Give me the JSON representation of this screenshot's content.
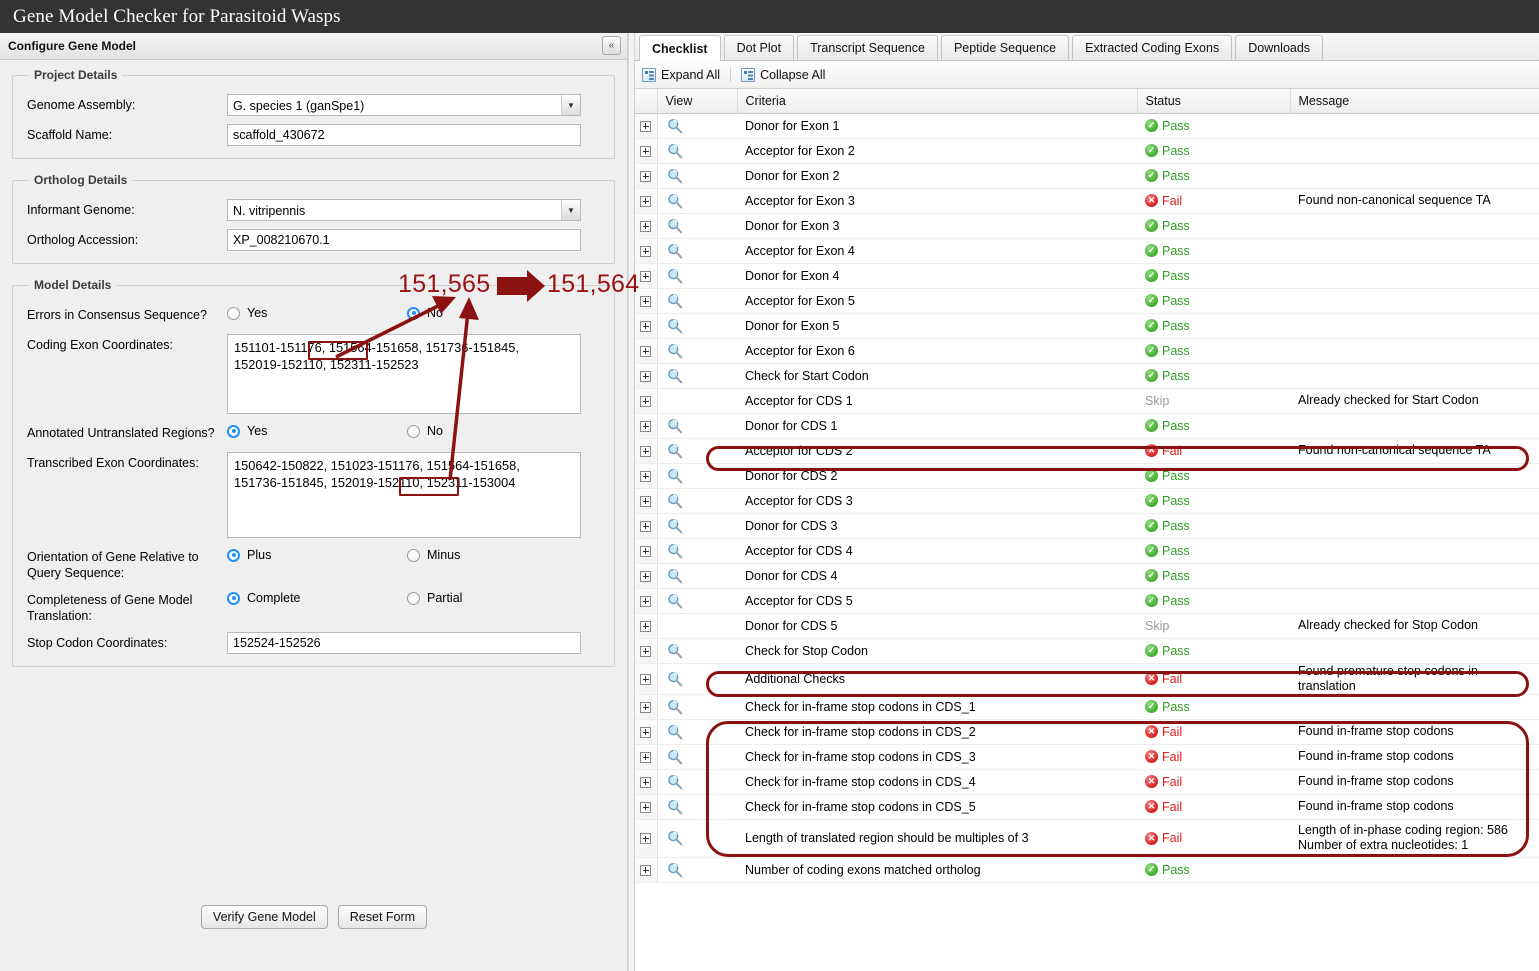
{
  "app": {
    "title": "Gene Model Checker for Parasitoid Wasps"
  },
  "left_panel": {
    "header_title": "Configure Gene Model",
    "collapse_icon": "double-chevron-left-icon",
    "collapse_glyph": "«",
    "groups": {
      "project_details": {
        "legend": "Project Details",
        "genome_assembly_label": "Genome Assembly:",
        "genome_assembly_value": "G. species 1 (ganSpe1)",
        "scaffold_label": "Scaffold Name:",
        "scaffold_value": "scaffold_430672"
      },
      "ortholog_details": {
        "legend": "Ortholog Details",
        "informant_genome_label": "Informant Genome:",
        "informant_genome_value": "N. vitripennis",
        "ortholog_accession_label": "Ortholog Accession:",
        "ortholog_accession_value": "XP_008210670.1"
      },
      "model_details": {
        "legend": "Model Details",
        "errors_label": "Errors in Consensus Sequence?",
        "errors_yes": "Yes",
        "errors_no": "No",
        "errors_selected": "No",
        "coding_exon_label": "Coding Exon Coordinates:",
        "coding_exon_value": "151101-151176, 151564-151658, 151736-151845,\n152019-152110, 152311-152523",
        "utr_label": "Annotated Untranslated Regions?",
        "utr_yes": "Yes",
        "utr_no": "No",
        "utr_selected": "Yes",
        "transcribed_exon_label": "Transcribed Exon Coordinates:",
        "transcribed_exon_value": "150642-150822, 151023-151176, 151564-151658,\n151736-151845, 152019-152110, 152311-153004",
        "orientation_label": "Orientation of Gene Relative to Query Sequence:",
        "orientation_plus": "Plus",
        "orientation_minus": "Minus",
        "orientation_selected": "Plus",
        "completeness_label": "Completeness of Gene Model Translation:",
        "completeness_complete": "Complete",
        "completeness_partial": "Partial",
        "completeness_selected": "Complete",
        "stop_codon_label": "Stop Codon Coordinates:",
        "stop_codon_value": "152524-152526"
      }
    },
    "buttons": {
      "verify": "Verify Gene Model",
      "reset": "Reset Form"
    }
  },
  "right_panel": {
    "tabs": [
      {
        "label": "Checklist",
        "active": true
      },
      {
        "label": "Dot Plot",
        "active": false
      },
      {
        "label": "Transcript Sequence",
        "active": false
      },
      {
        "label": "Peptide Sequence",
        "active": false
      },
      {
        "label": "Extracted Coding Exons",
        "active": false
      },
      {
        "label": "Downloads",
        "active": false
      }
    ],
    "toolbar": {
      "expand_all": "Expand All",
      "collapse_all": "Collapse All",
      "expand_icon": "expand-tree-icon",
      "collapse_icon": "collapse-tree-icon"
    },
    "table": {
      "columns": [
        "",
        "View",
        "Criteria",
        "Status",
        "Message"
      ],
      "rows": [
        {
          "criteria": "Donor for Exon 1",
          "status": "Pass",
          "message": "",
          "view": true
        },
        {
          "criteria": "Acceptor for Exon 2",
          "status": "Pass",
          "message": "",
          "view": true
        },
        {
          "criteria": "Donor for Exon 2",
          "status": "Pass",
          "message": "",
          "view": true
        },
        {
          "criteria": "Acceptor for Exon 3",
          "status": "Fail",
          "message": "Found non-canonical sequence TA",
          "view": true
        },
        {
          "criteria": "Donor for Exon 3",
          "status": "Pass",
          "message": "",
          "view": true
        },
        {
          "criteria": "Acceptor for Exon 4",
          "status": "Pass",
          "message": "",
          "view": true
        },
        {
          "criteria": "Donor for Exon 4",
          "status": "Pass",
          "message": "",
          "view": true
        },
        {
          "criteria": "Acceptor for Exon 5",
          "status": "Pass",
          "message": "",
          "view": true
        },
        {
          "criteria": "Donor for Exon 5",
          "status": "Pass",
          "message": "",
          "view": true
        },
        {
          "criteria": "Acceptor for Exon 6",
          "status": "Pass",
          "message": "",
          "view": true
        },
        {
          "criteria": "Check for Start Codon",
          "status": "Pass",
          "message": "",
          "view": true
        },
        {
          "criteria": "Acceptor for CDS 1",
          "status": "Skip",
          "message": "Already checked for Start Codon",
          "view": false
        },
        {
          "criteria": "Donor for CDS 1",
          "status": "Pass",
          "message": "",
          "view": true
        },
        {
          "criteria": "Acceptor for CDS 2",
          "status": "Fail",
          "message": "Found non-canonical sequence TA",
          "view": true
        },
        {
          "criteria": "Donor for CDS 2",
          "status": "Pass",
          "message": "",
          "view": true
        },
        {
          "criteria": "Acceptor for CDS 3",
          "status": "Pass",
          "message": "",
          "view": true
        },
        {
          "criteria": "Donor for CDS 3",
          "status": "Pass",
          "message": "",
          "view": true
        },
        {
          "criteria": "Acceptor for CDS 4",
          "status": "Pass",
          "message": "",
          "view": true
        },
        {
          "criteria": "Donor for CDS 4",
          "status": "Pass",
          "message": "",
          "view": true
        },
        {
          "criteria": "Acceptor for CDS 5",
          "status": "Pass",
          "message": "",
          "view": true
        },
        {
          "criteria": "Donor for CDS 5",
          "status": "Skip",
          "message": "Already checked for Stop Codon",
          "view": false
        },
        {
          "criteria": "Check for Stop Codon",
          "status": "Pass",
          "message": "",
          "view": true
        },
        {
          "criteria": "Additional Checks",
          "status": "Fail",
          "message": "Found premature stop codons in translation",
          "view": true
        },
        {
          "criteria": "Check for in-frame stop codons in CDS_1",
          "status": "Pass",
          "message": "",
          "view": true
        },
        {
          "criteria": "Check for in-frame stop codons in CDS_2",
          "status": "Fail",
          "message": "Found in-frame stop codons",
          "view": true
        },
        {
          "criteria": "Check for in-frame stop codons in CDS_3",
          "status": "Fail",
          "message": "Found in-frame stop codons",
          "view": true
        },
        {
          "criteria": "Check for in-frame stop codons in CDS_4",
          "status": "Fail",
          "message": "Found in-frame stop codons",
          "view": true
        },
        {
          "criteria": "Check for in-frame stop codons in CDS_5",
          "status": "Fail",
          "message": "Found in-frame stop codons",
          "view": true
        },
        {
          "criteria": "Length of translated region should be multiples of 3",
          "status": "Fail",
          "message": "Length of in-phase coding region: 586\nNumber of extra nucleotides: 1",
          "view": true,
          "tall": true
        },
        {
          "criteria": "Number of coding exons matched ortholog",
          "status": "Pass",
          "message": "",
          "view": true
        }
      ]
    }
  },
  "annotations": {
    "from_value": "151,565",
    "to_value": "151,564",
    "color": "#8c1212"
  }
}
